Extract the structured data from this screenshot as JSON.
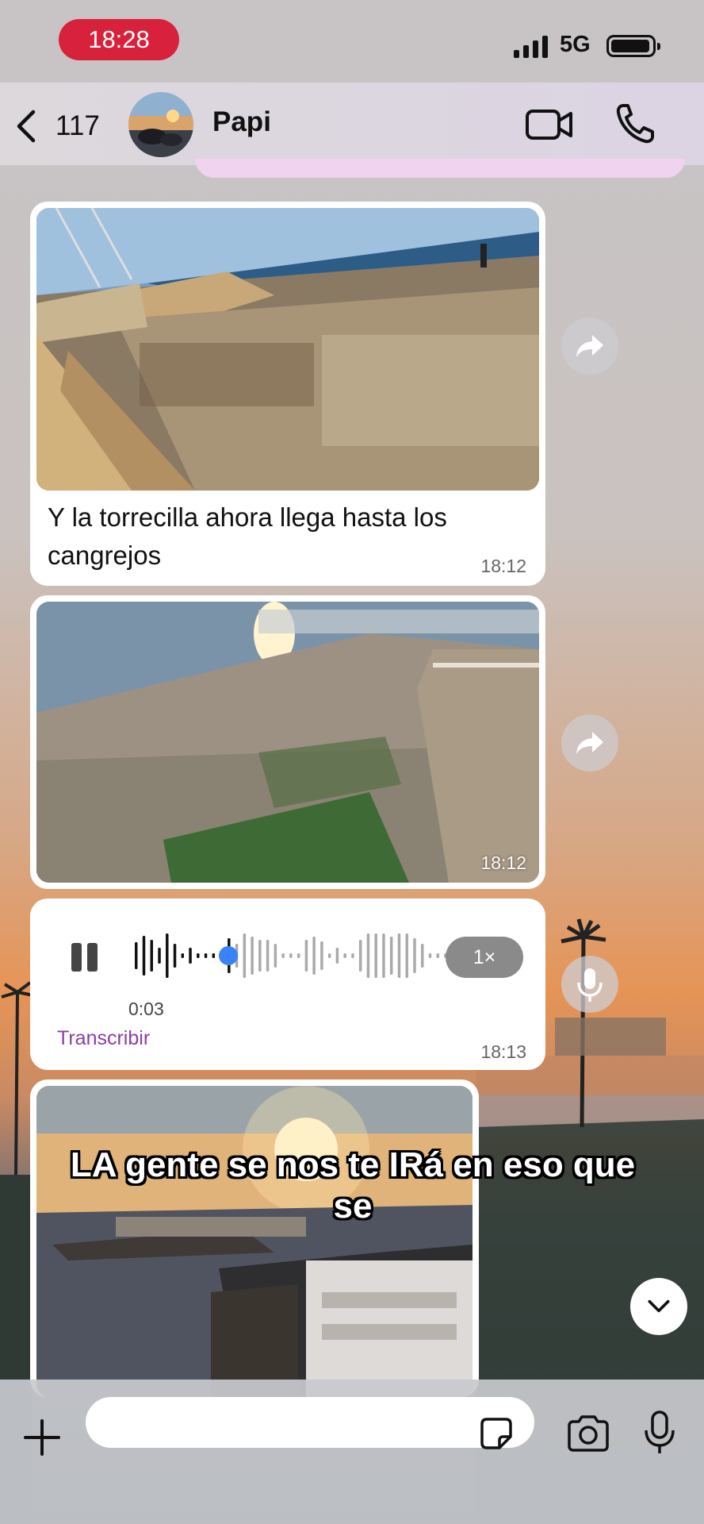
{
  "status_bar": {
    "time": "18:28",
    "network": "5G"
  },
  "header": {
    "back_count": "117",
    "contact_name": "Papi"
  },
  "messages": [
    {
      "type": "image",
      "caption": "Y la torrecilla ahora llega hasta los cangrejos",
      "time": "18:12"
    },
    {
      "type": "image",
      "caption": "",
      "time": "18:12"
    },
    {
      "type": "audio",
      "duration": "0:03",
      "speed": "1×",
      "transcribe_label": "Transcribir",
      "time": "18:13",
      "progress": 0.3
    },
    {
      "type": "image",
      "caption": "",
      "time": ""
    }
  ],
  "video_subtitle": "LA gente se nos te IRá en eso que se",
  "input": {
    "placeholder": ""
  },
  "colors": {
    "time_pill": "#d8213b",
    "transcribe": "#8b3da5",
    "audio_progress": "#3b82f6"
  }
}
